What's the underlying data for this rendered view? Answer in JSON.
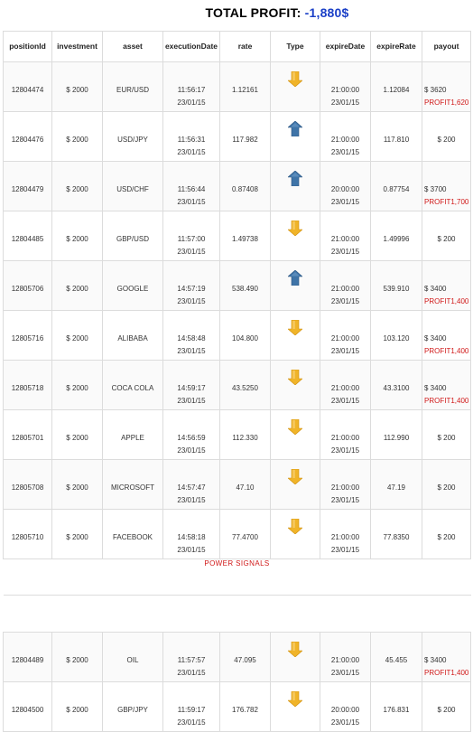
{
  "header": {
    "total_label": "TOTAL PROFIT:",
    "total_value": "-1,880$"
  },
  "colors": {
    "total_value": "#1a3fc7",
    "profit_text": "#d01818",
    "arrow_up": "#3f74a8",
    "arrow_down": "#f0b429"
  },
  "columns": [
    "positionId",
    "investment",
    "asset",
    "executionDate",
    "rate",
    "Type",
    "expireDate",
    "expireRate",
    "payout"
  ],
  "rows": [
    {
      "positionId": "12804474",
      "investment": "$ 2000",
      "asset": "EUR/USD",
      "exec_time": "11:56:17",
      "exec_date": "23/01/15",
      "rate": "1.12161",
      "type": "down-arrow-icon",
      "expire_time": "21:00:00",
      "expire_date": "23/01/15",
      "expireRate": "1.12084",
      "payout": "$ 3620",
      "profit": "PROFIT1,620"
    },
    {
      "positionId": "12804476",
      "investment": "$ 2000",
      "asset": "USD/JPY",
      "exec_time": "11:56:31",
      "exec_date": "23/01/15",
      "rate": "117.982",
      "type": "up-arrow-icon",
      "expire_time": "21:00:00",
      "expire_date": "23/01/15",
      "expireRate": "117.810",
      "payout": "$ 200",
      "profit": ""
    },
    {
      "positionId": "12804479",
      "investment": "$ 2000",
      "asset": "USD/CHF",
      "exec_time": "11:56:44",
      "exec_date": "23/01/15",
      "rate": "0.87408",
      "type": "up-arrow-icon",
      "expire_time": "20:00:00",
      "expire_date": "23/01/15",
      "expireRate": "0.87754",
      "payout": "$ 3700",
      "profit": "PROFIT1,700"
    },
    {
      "positionId": "12804485",
      "investment": "$ 2000",
      "asset": "GBP/USD",
      "exec_time": "11:57:00",
      "exec_date": "23/01/15",
      "rate": "1.49738",
      "type": "down-arrow-icon",
      "expire_time": "21:00:00",
      "expire_date": "23/01/15",
      "expireRate": "1.49996",
      "payout": "$ 200",
      "profit": ""
    },
    {
      "positionId": "12805706",
      "investment": "$ 2000",
      "asset": "GOOGLE",
      "exec_time": "14:57:19",
      "exec_date": "23/01/15",
      "rate": "538.490",
      "type": "up-arrow-icon",
      "expire_time": "21:00:00",
      "expire_date": "23/01/15",
      "expireRate": "539.910",
      "payout": "$ 3400",
      "profit": "PROFIT1,400"
    },
    {
      "positionId": "12805716",
      "investment": "$ 2000",
      "asset": "ALIBABA",
      "exec_time": "14:58:48",
      "exec_date": "23/01/15",
      "rate": "104.800",
      "type": "down-arrow-icon",
      "expire_time": "21:00:00",
      "expire_date": "23/01/15",
      "expireRate": "103.120",
      "payout": "$ 3400",
      "profit": "PROFIT1,400"
    },
    {
      "positionId": "12805718",
      "investment": "$ 2000",
      "asset": "COCA COLA",
      "exec_time": "14:59:17",
      "exec_date": "23/01/15",
      "rate": "43.5250",
      "type": "down-arrow-icon",
      "expire_time": "21:00:00",
      "expire_date": "23/01/15",
      "expireRate": "43.3100",
      "payout": "$ 3400",
      "profit": "PROFIT1,400"
    },
    {
      "positionId": "12805701",
      "investment": "$ 2000",
      "asset": "APPLE",
      "exec_time": "14:56:59",
      "exec_date": "23/01/15",
      "rate": "112.330",
      "type": "down-arrow-icon",
      "expire_time": "21:00:00",
      "expire_date": "23/01/15",
      "expireRate": "112.990",
      "payout": "$ 200",
      "profit": ""
    },
    {
      "positionId": "12805708",
      "investment": "$ 2000",
      "asset": "MICROSOFT",
      "exec_time": "14:57:47",
      "exec_date": "23/01/15",
      "rate": "47.10",
      "type": "down-arrow-icon",
      "expire_time": "21:00:00",
      "expire_date": "23/01/15",
      "expireRate": "47.19",
      "payout": "$ 200",
      "profit": ""
    },
    {
      "positionId": "12805710",
      "investment": "$ 2000",
      "asset": "FACEBOOK",
      "exec_time": "14:58:18",
      "exec_date": "23/01/15",
      "rate": "77.4700",
      "type": "down-arrow-icon",
      "expire_time": "21:00:00",
      "expire_date": "23/01/15",
      "expireRate": "77.8350",
      "payout": "$ 200",
      "profit": ""
    }
  ],
  "section_label": "POWER SIGNALS",
  "rows2": [
    {
      "positionId": "12804489",
      "investment": "$ 2000",
      "asset": "OIL",
      "exec_time": "11:57:57",
      "exec_date": "23/01/15",
      "rate": "47.095",
      "type": "down-arrow-icon",
      "expire_time": "21:00:00",
      "expire_date": "23/01/15",
      "expireRate": "45.455",
      "payout": "$ 3400",
      "profit": "PROFIT1,400"
    },
    {
      "positionId": "12804500",
      "investment": "$ 2000",
      "asset": "GBP/JPY",
      "exec_time": "11:59:17",
      "exec_date": "23/01/15",
      "rate": "176.782",
      "type": "down-arrow-icon",
      "expire_time": "20:00:00",
      "expire_date": "23/01/15",
      "expireRate": "176.831",
      "payout": "$ 200",
      "profit": ""
    }
  ]
}
